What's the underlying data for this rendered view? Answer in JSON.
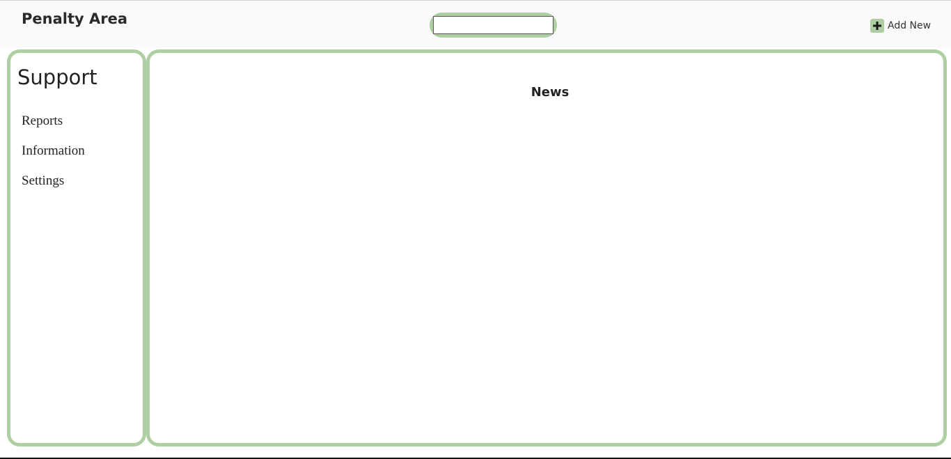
{
  "header": {
    "brand": "Penalty Area",
    "search": {
      "value": "",
      "placeholder": ""
    },
    "add_new": {
      "label": "Add New",
      "icon": "plus-icon"
    }
  },
  "sidebar": {
    "title": "Support",
    "items": [
      {
        "label": "Reports"
      },
      {
        "label": "Information"
      },
      {
        "label": "Settings"
      }
    ]
  },
  "main": {
    "title": "News"
  },
  "colors": {
    "accent": "#adcfa2",
    "header_bg": "#fafafa",
    "text": "#222222"
  }
}
